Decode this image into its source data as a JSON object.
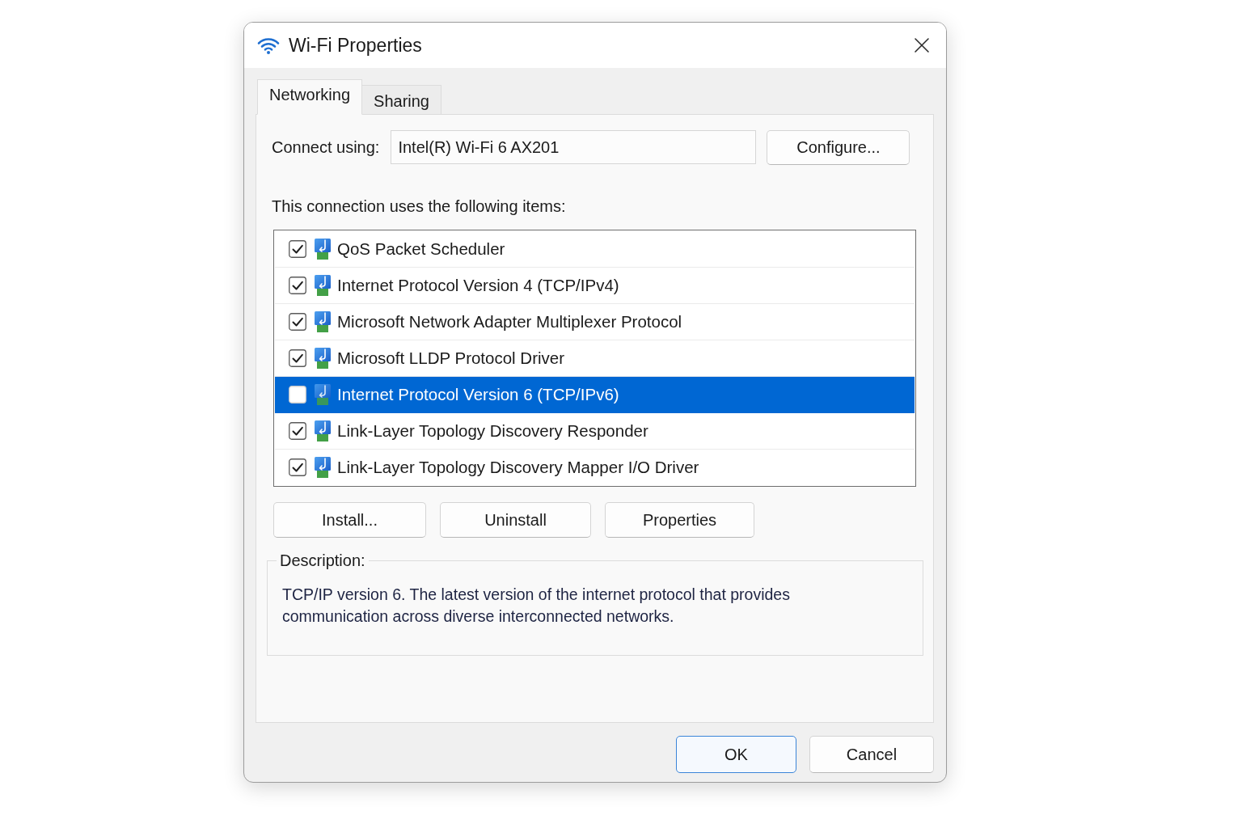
{
  "window": {
    "title": "Wi-Fi Properties"
  },
  "tabs": [
    {
      "label": "Networking",
      "selected": true
    },
    {
      "label": "Sharing",
      "selected": false
    }
  ],
  "connect_using": {
    "label": "Connect using:",
    "value": "Intel(R) Wi-Fi 6 AX201",
    "button": "Configure..."
  },
  "items_heading": "This connection uses the following items:",
  "items": [
    {
      "label": "QoS Packet Scheduler",
      "checked": true,
      "selected": false
    },
    {
      "label": "Internet Protocol Version 4 (TCP/IPv4)",
      "checked": true,
      "selected": false
    },
    {
      "label": "Microsoft Network Adapter Multiplexer Protocol",
      "checked": true,
      "selected": false
    },
    {
      "label": "Microsoft LLDP Protocol Driver",
      "checked": true,
      "selected": false
    },
    {
      "label": "Internet Protocol Version 6 (TCP/IPv6)",
      "checked": false,
      "selected": true
    },
    {
      "label": "Link-Layer Topology Discovery Responder",
      "checked": true,
      "selected": false
    },
    {
      "label": "Link-Layer Topology Discovery Mapper I/O Driver",
      "checked": true,
      "selected": false
    }
  ],
  "item_buttons": [
    "Install...",
    "Uninstall",
    "Properties"
  ],
  "description": {
    "legend": "Description:",
    "text": "TCP/IP version 6. The latest version of the internet protocol that provides communication across diverse interconnected networks."
  },
  "dialog_buttons": [
    {
      "label": "OK",
      "default": true
    },
    {
      "label": "Cancel",
      "default": false
    }
  ]
}
